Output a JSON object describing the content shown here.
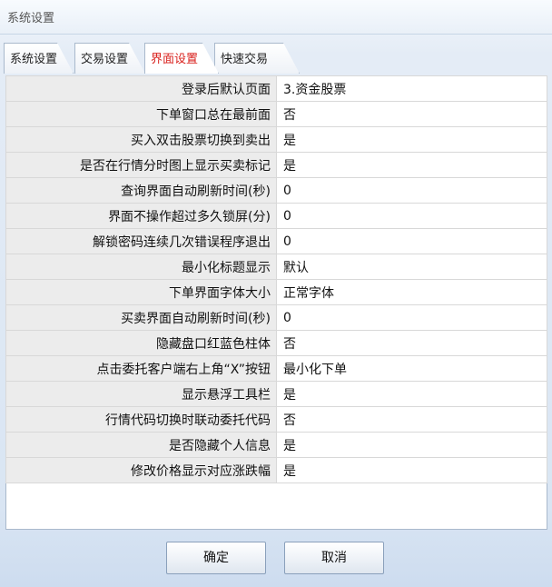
{
  "window": {
    "title": "系统设置"
  },
  "tabs": [
    {
      "label": "系统设置",
      "active": false
    },
    {
      "label": "交易设置",
      "active": false
    },
    {
      "label": "界面设置",
      "active": true
    },
    {
      "label": "快速交易",
      "active": false
    }
  ],
  "settings": {
    "rows": [
      {
        "label": "登录后默认页面",
        "value": "3.资金股票"
      },
      {
        "label": "下单窗口总在最前面",
        "value": "否"
      },
      {
        "label": "买入双击股票切换到卖出",
        "value": "是"
      },
      {
        "label": "是否在行情分时图上显示买卖标记",
        "value": "是"
      },
      {
        "label": "查询界面自动刷新时间(秒)",
        "value": "0"
      },
      {
        "label": "界面不操作超过多久锁屏(分)",
        "value": "0"
      },
      {
        "label": "解锁密码连续几次错误程序退出",
        "value": "0"
      },
      {
        "label": "最小化标题显示",
        "value": "默认"
      },
      {
        "label": "下单界面字体大小",
        "value": "正常字体"
      },
      {
        "label": "买卖界面自动刷新时间(秒)",
        "value": "0"
      },
      {
        "label": "隐藏盘口红蓝色柱体",
        "value": "否"
      },
      {
        "label": "点击委托客户端右上角“X”按钮",
        "value": "最小化下单"
      },
      {
        "label": "显示悬浮工具栏",
        "value": "是"
      },
      {
        "label": "行情代码切换时联动委托代码",
        "value": "否"
      },
      {
        "label": "是否隐藏个人信息",
        "value": "是"
      },
      {
        "label": "修改价格显示对应涨跌幅",
        "value": "是"
      }
    ]
  },
  "buttons": {
    "confirm_label": "确定",
    "cancel_label": "取消"
  },
  "colors": {
    "active_tab_text": "#d9201c",
    "label_cell_bg": "#ececec",
    "border": "#a9b9cc"
  }
}
